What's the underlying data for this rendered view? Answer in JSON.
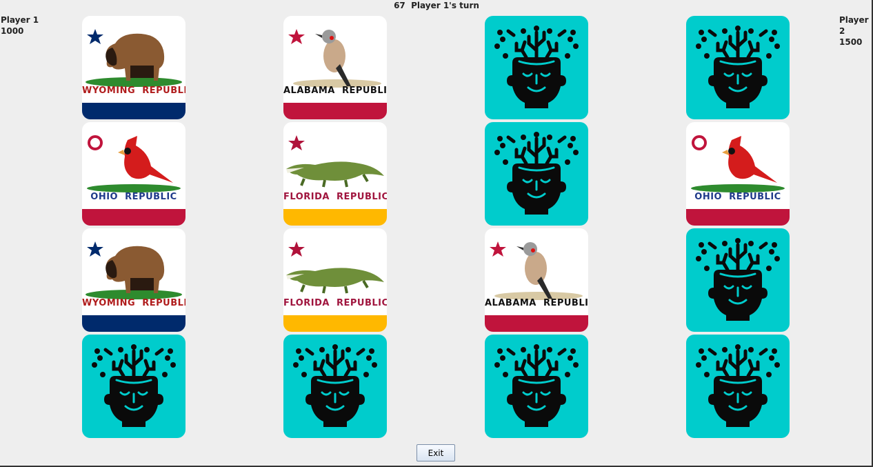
{
  "status": {
    "turn_number": "67",
    "turn_text": "Player 1's turn"
  },
  "players": [
    {
      "name": "Player 1",
      "score": "1000"
    },
    {
      "name": "Player 2",
      "score": "1500"
    }
  ],
  "flags": {
    "wyoming": {
      "left": "WYOMING",
      "right": "REPUBLIC",
      "text_color": "#b01c1c",
      "stripe_color": "#002a6c",
      "symbol": "star",
      "symbol_color": "#002a6c",
      "animal": "bison"
    },
    "alabama": {
      "left": "ALABAMA",
      "right": "REPUBLIC",
      "text_color": "#111111",
      "stripe_color": "#c0143c",
      "symbol": "star",
      "symbol_color": "#c0143c",
      "animal": "flicker"
    },
    "ohio": {
      "left": "OHIO",
      "right": "REPUBLIC",
      "text_color": "#1f3a8a",
      "stripe_color": "#c0143c",
      "symbol": "ring",
      "symbol_color": "#c0143c",
      "animal": "cardinal"
    },
    "florida": {
      "left": "FLORIDA",
      "right": "REPUBLIC",
      "text_color": "#a0153e",
      "stripe_color": "#ffb800",
      "symbol": "star",
      "symbol_color": "#b0123a",
      "animal": "alligator"
    }
  },
  "cards": [
    {
      "state": "face-up",
      "flag": "wyoming"
    },
    {
      "state": "face-up",
      "flag": "alabama"
    },
    {
      "state": "face-down"
    },
    {
      "state": "face-down"
    },
    {
      "state": "face-up",
      "flag": "ohio"
    },
    {
      "state": "face-up",
      "flag": "florida"
    },
    {
      "state": "face-down"
    },
    {
      "state": "face-up",
      "flag": "ohio"
    },
    {
      "state": "face-up",
      "flag": "wyoming"
    },
    {
      "state": "face-up",
      "flag": "florida"
    },
    {
      "state": "face-up",
      "flag": "alabama"
    },
    {
      "state": "face-down"
    },
    {
      "state": "face-down"
    },
    {
      "state": "face-down"
    },
    {
      "state": "face-down"
    },
    {
      "state": "face-down"
    }
  ],
  "card_back": {
    "color": "#00cccc",
    "icon": "mind-head-icon"
  },
  "exit_label": "Exit"
}
